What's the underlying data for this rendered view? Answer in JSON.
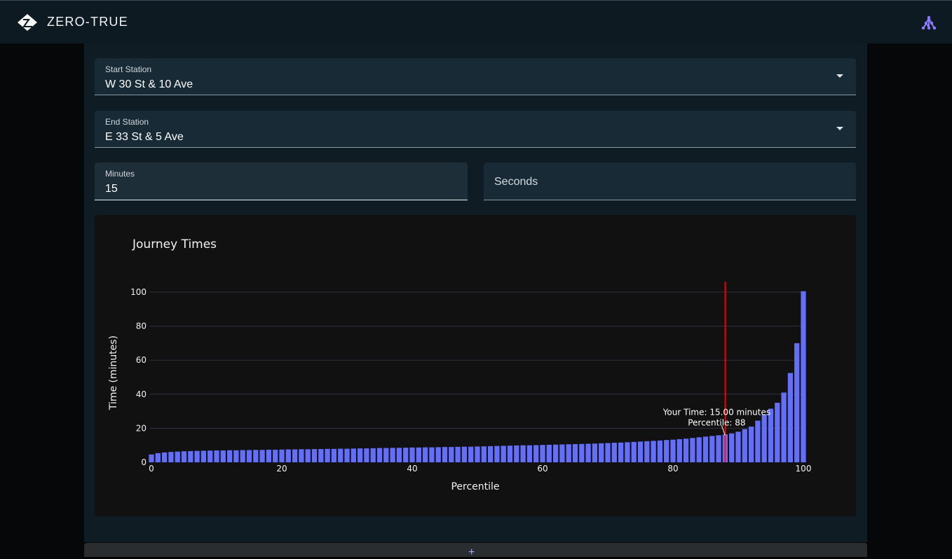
{
  "app": {
    "title": "ZERO-TRUE",
    "logo_icon": "zero-true-logo-icon",
    "tree_icon": "sitemap-icon",
    "accent": "#8c7bff"
  },
  "form": {
    "start_station": {
      "label": "Start Station",
      "value": "W 30 St & 10 Ave"
    },
    "end_station": {
      "label": "End Station",
      "value": "E 33 St & 5 Ave"
    },
    "minutes": {
      "label": "Minutes",
      "value": "15"
    },
    "seconds": {
      "placeholder": "Seconds"
    }
  },
  "footer": {
    "add_label": "+"
  },
  "chart_data": {
    "type": "bar",
    "title": "Journey Times",
    "xlabel": "Percentile",
    "ylabel": "Time (minutes)",
    "xlim": [
      0,
      100
    ],
    "ylim": [
      0,
      100
    ],
    "xticks": [
      0,
      20,
      40,
      60,
      80,
      100
    ],
    "yticks": [
      0,
      20,
      40,
      60,
      80,
      100
    ],
    "grid": true,
    "bar_color": "#636efa",
    "x": [
      0,
      1,
      2,
      3,
      4,
      5,
      6,
      7,
      8,
      9,
      10,
      11,
      12,
      13,
      14,
      15,
      16,
      17,
      18,
      19,
      20,
      21,
      22,
      23,
      24,
      25,
      26,
      27,
      28,
      29,
      30,
      31,
      32,
      33,
      34,
      35,
      36,
      37,
      38,
      39,
      40,
      41,
      42,
      43,
      44,
      45,
      46,
      47,
      48,
      49,
      50,
      51,
      52,
      53,
      54,
      55,
      56,
      57,
      58,
      59,
      60,
      61,
      62,
      63,
      64,
      65,
      66,
      67,
      68,
      69,
      70,
      71,
      72,
      73,
      74,
      75,
      76,
      77,
      78,
      79,
      80,
      81,
      82,
      83,
      84,
      85,
      86,
      87,
      88,
      89,
      90,
      91,
      92,
      93,
      94,
      95,
      96,
      97,
      98,
      99,
      100
    ],
    "values": [
      4.6,
      5.4,
      5.8,
      6.1,
      6.3,
      6.5,
      6.6,
      6.7,
      6.8,
      6.9,
      7.0,
      7.0,
      7.1,
      7.1,
      7.2,
      7.2,
      7.3,
      7.3,
      7.4,
      7.4,
      7.5,
      7.6,
      7.6,
      7.7,
      7.7,
      7.8,
      7.8,
      7.9,
      7.9,
      8.0,
      8.0,
      8.1,
      8.2,
      8.2,
      8.3,
      8.4,
      8.4,
      8.5,
      8.5,
      8.6,
      8.7,
      8.7,
      8.8,
      8.8,
      8.9,
      9.0,
      9.0,
      9.1,
      9.2,
      9.2,
      9.3,
      9.4,
      9.5,
      9.6,
      9.7,
      9.8,
      9.9,
      10.0,
      10.0,
      10.1,
      10.2,
      10.3,
      10.4,
      10.5,
      10.6,
      10.7,
      10.8,
      10.9,
      11.0,
      11.2,
      11.3,
      11.5,
      11.6,
      11.8,
      12.0,
      12.2,
      12.4,
      12.6,
      12.8,
      13.1,
      13.3,
      13.6,
      13.9,
      14.3,
      14.7,
      15.1,
      15.5,
      15.9,
      16.4,
      17.0,
      18.0,
      19.5,
      21.0,
      24.5,
      28.0,
      31.5,
      35.0,
      41.0,
      52.5,
      70.0,
      100.5
    ],
    "annotation": {
      "text_line1": "Your Time: 15.00 minutes",
      "text_line2": "Percentile: 88",
      "x": 88,
      "y": 15
    },
    "marker_line": {
      "x": 88,
      "color": "#ff0000"
    }
  }
}
